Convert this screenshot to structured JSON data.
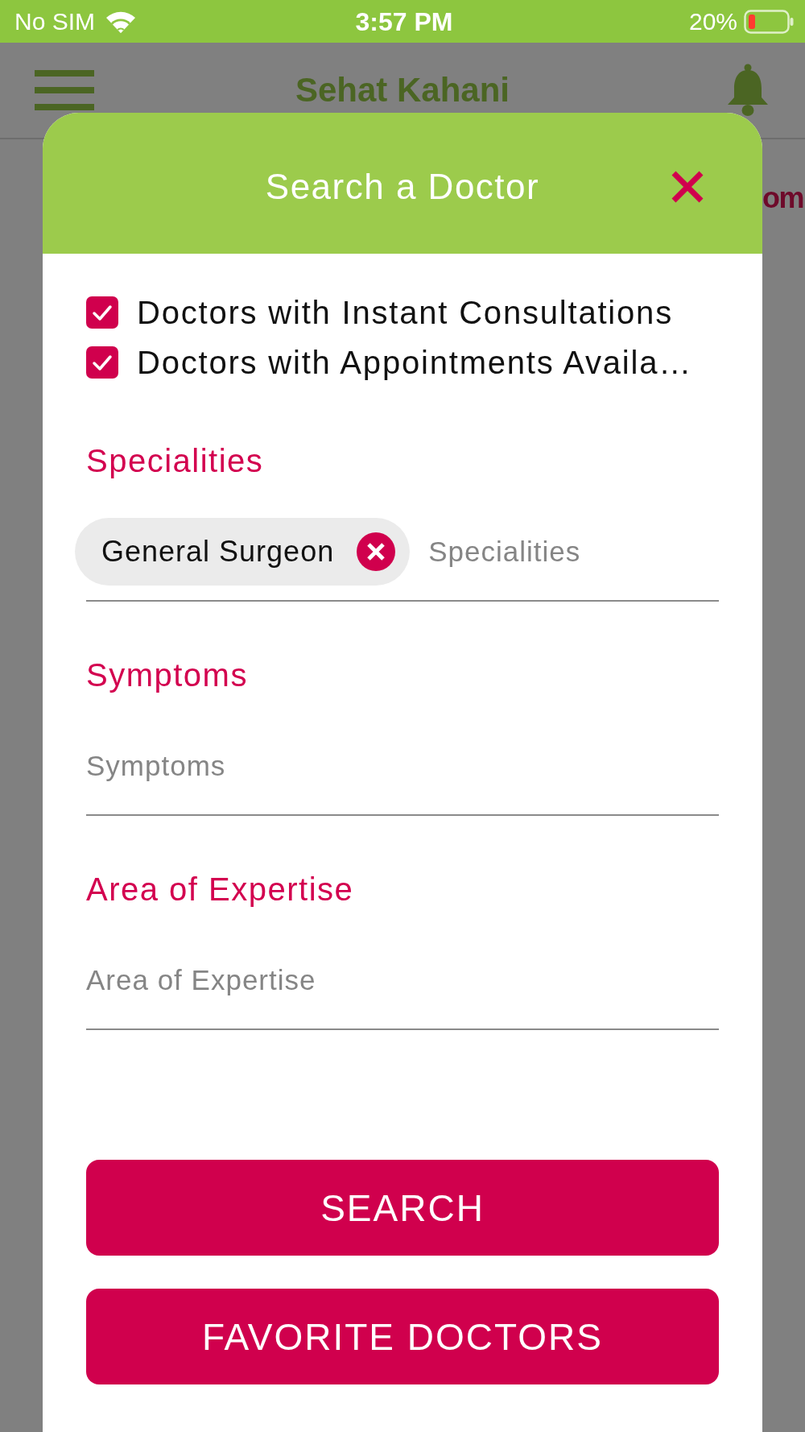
{
  "status_bar": {
    "carrier": "No SIM",
    "time": "3:57 PM",
    "battery_percent": "20%"
  },
  "app_bar": {
    "title": "Sehat Kahani"
  },
  "background_page": {
    "text_fragment": "om"
  },
  "dialog": {
    "title": "Search a Doctor",
    "filters": [
      {
        "label": "Doctors with Instant Consultations",
        "checked": true
      },
      {
        "label": "Doctors with Appointments Availa…",
        "checked": true
      }
    ],
    "fields": [
      {
        "label": "Specialities",
        "chips": [
          {
            "label": "General Surgeon"
          }
        ],
        "placeholder": "Specialities"
      },
      {
        "label": "Symptoms",
        "placeholder": "Symptoms"
      },
      {
        "label": "Area of Expertise",
        "placeholder": "Area of Expertise"
      }
    ],
    "buttons": [
      {
        "label": "SEARCH"
      },
      {
        "label": "FAVORITE DOCTORS"
      }
    ]
  }
}
